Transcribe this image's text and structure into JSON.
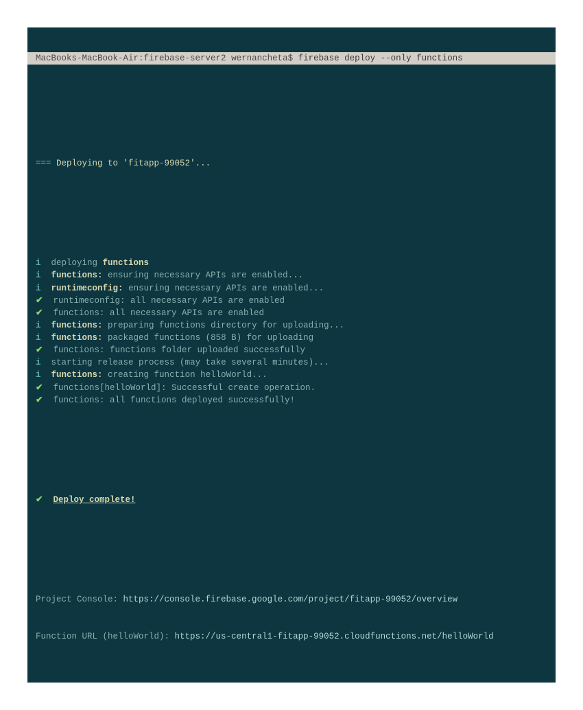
{
  "prompt": {
    "host": "MacBooks-MacBook-Air:",
    "path": "firebase-server2",
    "user": " wernancheta$ ",
    "command": "firebase deploy --only functions"
  },
  "deploying_to": "Deploying to 'fitapp-99052'...",
  "lines": [
    {
      "sym": "i",
      "prefix": "deploying ",
      "bold": "functions",
      "rest": ""
    },
    {
      "sym": "i",
      "prefix": "",
      "bold": "functions:",
      "rest": " ensuring necessary APIs are enabled..."
    },
    {
      "sym": "i",
      "prefix": "",
      "bold": "runtimeconfig:",
      "rest": " ensuring necessary APIs are enabled..."
    },
    {
      "sym": "check",
      "prefix": "",
      "bold": "",
      "rest": "runtimeconfig: all necessary APIs are enabled"
    },
    {
      "sym": "check",
      "prefix": "",
      "bold": "",
      "rest": "functions: all necessary APIs are enabled"
    },
    {
      "sym": "i",
      "prefix": "",
      "bold": "functions:",
      "rest": " preparing functions directory for uploading..."
    },
    {
      "sym": "i",
      "prefix": "",
      "bold": "functions:",
      "rest": " packaged functions (858 B) for uploading"
    },
    {
      "sym": "check",
      "prefix": "",
      "bold": "",
      "rest": "functions: functions folder uploaded successfully"
    },
    {
      "sym": "i",
      "prefix": "",
      "bold": "",
      "rest": "starting release process (may take several minutes)..."
    },
    {
      "sym": "i",
      "prefix": "",
      "bold": "functions:",
      "rest": " creating function helloWorld..."
    },
    {
      "sym": "check",
      "prefix": "",
      "bold": "",
      "rest": "functions[helloWorld]: Successful create operation."
    },
    {
      "sym": "check",
      "prefix": "",
      "bold": "",
      "rest": "functions: all functions deployed successfully!"
    }
  ],
  "deploy_complete": "Deploy complete!",
  "console_label": "Project Console: ",
  "console_url": "https://console.firebase.google.com/project/fitapp-99052/overview",
  "function_label": "Function URL (helloWorld): ",
  "function_url": "https://us-central1-fitapp-99052.cloudfunctions.net/helloWorld"
}
